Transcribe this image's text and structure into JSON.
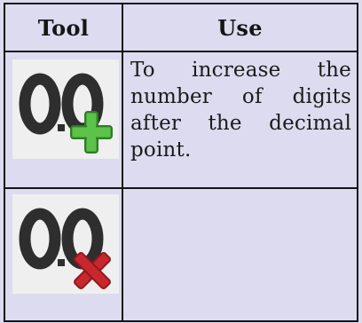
{
  "table": {
    "headers": [
      "Tool",
      "Use"
    ],
    "rows": [
      {
        "icon": "increase-decimal-icon",
        "use": "To increase the number of digits after the decimal point."
      },
      {
        "icon": "decrease-decimal-icon",
        "use": ""
      }
    ]
  },
  "colors": {
    "background": "#dcdbef",
    "border": "#141414",
    "plus_green": "#49a83a",
    "cross_red": "#c8282d"
  }
}
